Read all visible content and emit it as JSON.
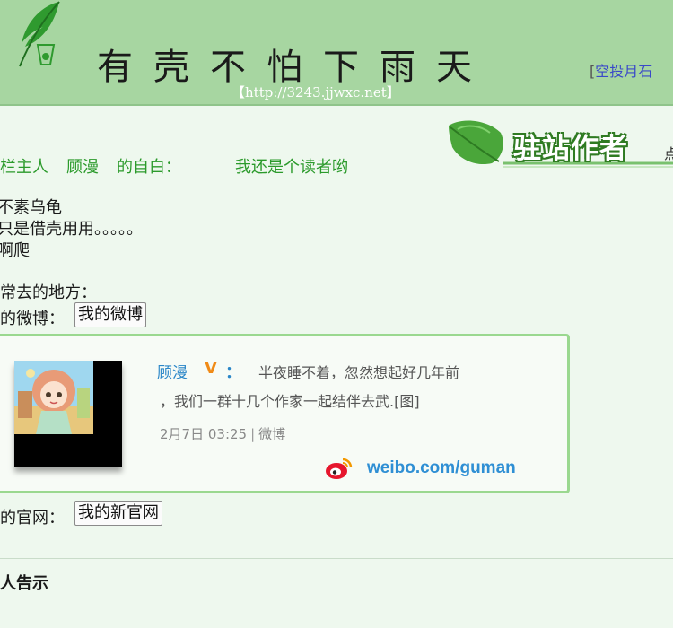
{
  "header": {
    "site_title": "有壳不怕下雨天",
    "site_url": "【http://3243.jjwxc.net】",
    "space_link": "空投月石",
    "space_link_open": "["
  },
  "ribbon": {
    "title": "驻站作者",
    "tail": "点"
  },
  "intro": {
    "owner_label": "栏主人",
    "owner_name": "顾漫",
    "self_label": "的自白：",
    "self_text": "我还是个读者哟"
  },
  "bio": {
    "lines": "不素乌龟\n只是借壳用用。。。。。\n啊爬"
  },
  "places": {
    "heading": "常去的地方：",
    "weibo_label": "的微博：",
    "weibo_button": "我的微博",
    "site_label": "的官网：",
    "site_button": "我的新官网"
  },
  "weibo_card": {
    "user": "顾漫",
    "verified_mark": "V",
    "colon": "：",
    "text_line1": "半夜睡不着，忽然想起好几年前",
    "text_line2": "，我们一群十几个作家一起结伴去武.[图]",
    "date": "2月7日 03:25",
    "separator": "|",
    "source": "微博",
    "domain": "weibo.com/guman"
  },
  "notice": {
    "title": "人告示"
  },
  "colors": {
    "header_bg": "#a7d6a1",
    "page_bg": "#eef8ee",
    "intro_green": "#2b9a2b",
    "weibo_blue": "#2f8fd4",
    "verified_orange": "#f08a16"
  },
  "icons": [
    "feather-logo-icon",
    "leaf-icon",
    "weibo-logo-icon"
  ]
}
